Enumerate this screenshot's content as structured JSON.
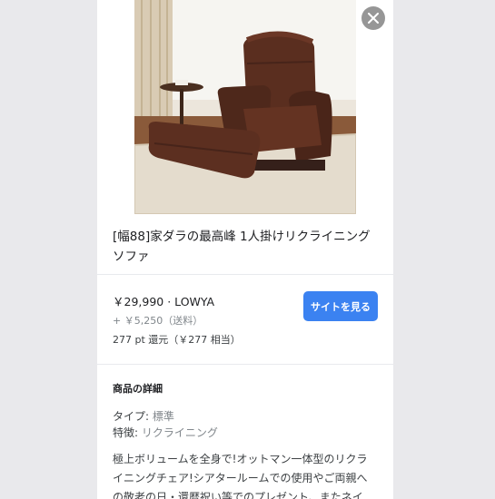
{
  "product": {
    "title": "[幅88]家ダラの最高峰 1人掛けリクライニングソファ",
    "title_line1": "[幅88]家ダラの最高峰 1人掛けリクライニング",
    "title_line2": "ソファ",
    "image_alt": "brown reclining armchair"
  },
  "offer": {
    "price": "￥29,990",
    "separator": " · ",
    "seller": "LOWYA",
    "shipping": "+ ￥5,250（送料）",
    "points": "277 pt 還元（￥277 相当）",
    "site_button_label": "サイトを見る"
  },
  "details": {
    "heading": "商品の詳細",
    "specs": [
      {
        "label": "タイプ: ",
        "value": "標準"
      },
      {
        "label": "特徴: ",
        "value": "リクライニング"
      }
    ],
    "description": "極上ボリュームを全身で!オットマン一体型のリクラ\nイニングチェア!シアタールームでの使用やご両親へ\nの敬老の日・還暦祝い等でのプレゼント、またネイ"
  },
  "colors": {
    "accent": "#3b82f1",
    "side_background": "#e9e9ec"
  },
  "icons": {
    "close": "close-icon"
  }
}
